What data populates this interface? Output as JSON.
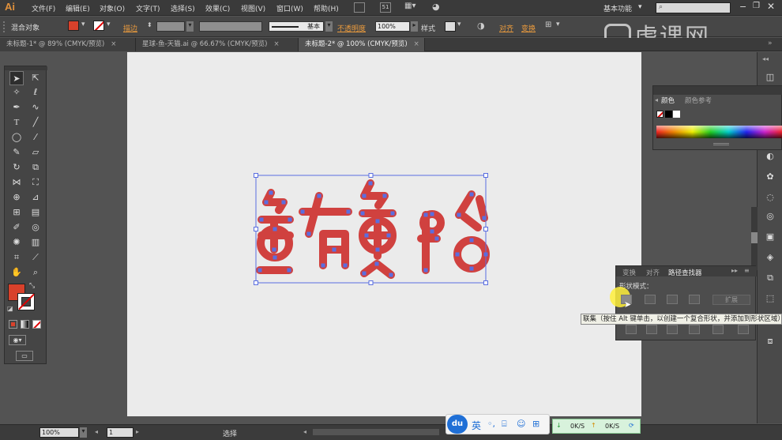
{
  "app": {
    "logo": "Ai",
    "workspace": "基本功能",
    "search_placeholder": ""
  },
  "menu": [
    "文件(F)",
    "编辑(E)",
    "对象(O)",
    "文字(T)",
    "选择(S)",
    "效果(C)",
    "视图(V)",
    "窗口(W)",
    "帮助(H)"
  ],
  "menu_badge": "51",
  "control_bar": {
    "selection_label": "混合对象",
    "fill_color": "#d8412b",
    "stroke_label": "描边",
    "brush_label": "基本",
    "opacity_label": "不透明度",
    "opacity_value": "100%",
    "style_label": "样式",
    "align_label": "对齐",
    "transform_label": "变换"
  },
  "tabs": [
    {
      "label": "未标题-1* @ 89% (CMYK/预览)",
      "close": "×"
    },
    {
      "label": "星球-鱼-天猫.ai @ 66.67% (CMYK/预览)",
      "close": "×"
    },
    {
      "label": "未标题-2* @ 100% (CMYK/预览)",
      "close": "×"
    }
  ],
  "artwork": {
    "glyph_color": "#d0413f",
    "anchor_color": "#5a6ee0"
  },
  "color_panel": {
    "tab_active": "颜色",
    "tab_other": "颜色参考"
  },
  "pathfinder": {
    "tabs": [
      "变换",
      "对齐",
      "路径查找器"
    ],
    "shape_modes_label": "形状模式：",
    "expand_label": "扩展"
  },
  "tooltip": "联集（按住 Alt 键单击，以创建一个复合形状，并添加到形状区域）",
  "status": {
    "zoom": "100%",
    "page": "1",
    "tool": "选择"
  },
  "ime": {
    "lang": "英"
  },
  "net": {
    "down": "0K/S",
    "up": "0K/S"
  },
  "watermark": "虎课网"
}
